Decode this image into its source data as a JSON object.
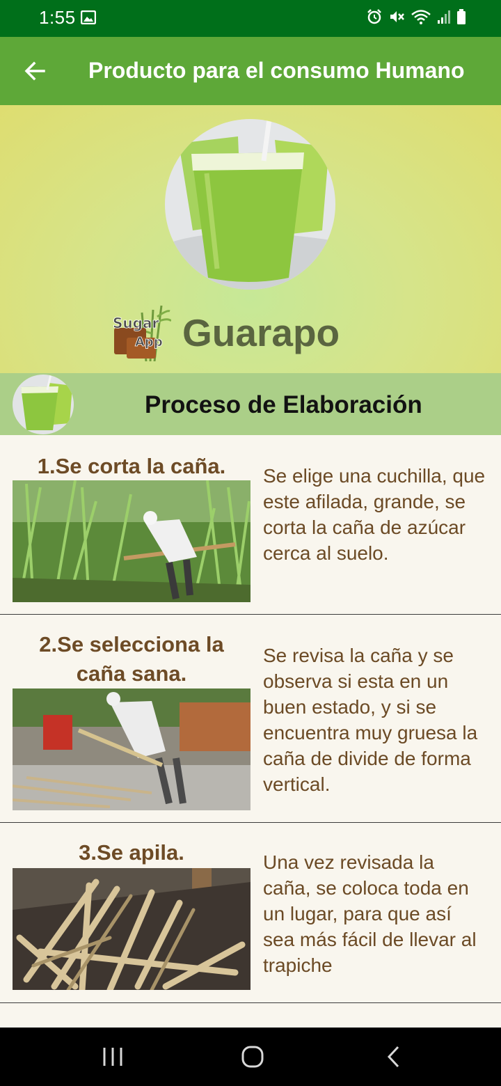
{
  "status_bar": {
    "time": "1:55",
    "icons": [
      "image-icon",
      "alarm-icon",
      "mute-icon",
      "wifi-icon",
      "signal-icon",
      "battery-icon"
    ]
  },
  "app_bar": {
    "title": "Producto para el consumo Humano",
    "back_icon": "arrow-left-icon",
    "background": "#5ea838"
  },
  "hero": {
    "product_name": "Guarapo",
    "logo_text_top": "Sugar",
    "logo_text_bottom": "App"
  },
  "section": {
    "title": "Proceso de Elaboración",
    "background": "#abcf88"
  },
  "steps": [
    {
      "title": "1.Se corta la caña.",
      "description": "Se elige una cuchilla, que este afilada, grande, se corta la caña de azúcar cerca al suelo."
    },
    {
      "title": "2.Se selecciona la caña sana.",
      "description": "Se revisa la caña y se observa si esta en un buen estado, y si se encuentra muy gruesa la caña de divide de forma vertical."
    },
    {
      "title": "3.Se apila.",
      "description": "Una vez revisada la caña, se coloca toda en un lugar, para que así sea más fácil de llevar al trapiche"
    },
    {
      "title": ""
    }
  ],
  "nav_bar": {
    "recents_icon": "recents-icon",
    "home_icon": "home-icon",
    "back_icon": "chevron-left-icon"
  }
}
